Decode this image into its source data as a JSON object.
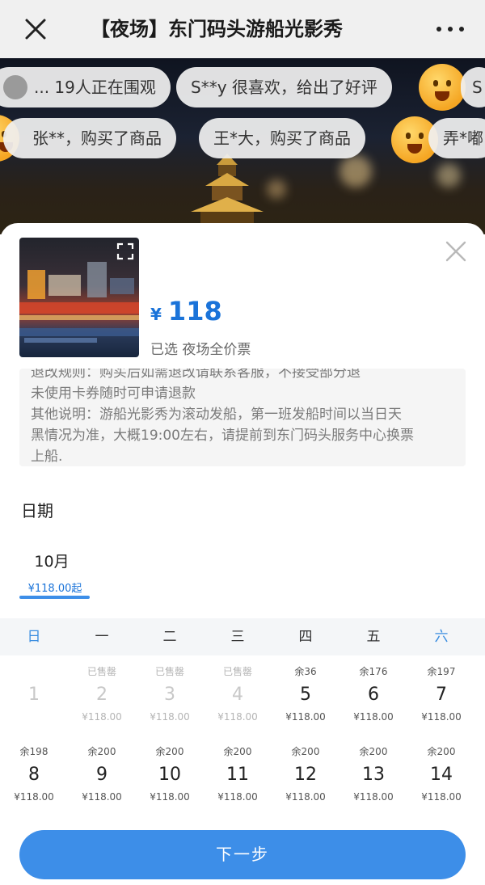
{
  "nav": {
    "title": "【夜场】东门码头游船光影秀"
  },
  "hero": {
    "bubbles": [
      {
        "text": "... 19人正在围观"
      },
      {
        "text": "S**y 很喜欢，给出了好评"
      },
      {
        "text": "S"
      },
      {
        "text": "张**，购买了商品"
      },
      {
        "text": "王*大，购买了商品"
      },
      {
        "text": "弄*嘟"
      }
    ]
  },
  "product": {
    "currency": "¥",
    "price": "118",
    "selected_prefix": "已选",
    "selected_name": "夜场全价票"
  },
  "info": {
    "lines": [
      "退改规则：购买后如需退改请联系客服，不接受部分退",
      "未使用卡券随时可申请退款",
      "其他说明：游船光影秀为滚动发船，第一班发船时间以当日天",
      "黑情况为准，大概19:00左右，请提前到东门码头服务中心换票",
      "上船."
    ]
  },
  "date": {
    "label": "日期",
    "month": "10月",
    "month_price": "¥118.00起"
  },
  "weekdays": [
    "日",
    "一",
    "二",
    "三",
    "四",
    "五",
    "六"
  ],
  "calendar": {
    "rows": [
      [
        {
          "avail": "",
          "day": "1",
          "price": "",
          "disabled": true
        },
        {
          "avail": "已售罄",
          "day": "2",
          "price": "¥118.00",
          "disabled": true
        },
        {
          "avail": "已售罄",
          "day": "3",
          "price": "¥118.00",
          "disabled": true
        },
        {
          "avail": "已售罄",
          "day": "4",
          "price": "¥118.00",
          "disabled": true
        },
        {
          "avail": "余36",
          "day": "5",
          "price": "¥118.00",
          "disabled": false
        },
        {
          "avail": "余176",
          "day": "6",
          "price": "¥118.00",
          "disabled": false
        },
        {
          "avail": "余197",
          "day": "7",
          "price": "¥118.00",
          "disabled": false
        }
      ],
      [
        {
          "avail": "余198",
          "day": "8",
          "price": "¥118.00",
          "disabled": false
        },
        {
          "avail": "余200",
          "day": "9",
          "price": "¥118.00",
          "disabled": false
        },
        {
          "avail": "余200",
          "day": "10",
          "price": "¥118.00",
          "disabled": false
        },
        {
          "avail": "余200",
          "day": "11",
          "price": "¥118.00",
          "disabled": false
        },
        {
          "avail": "余200",
          "day": "12",
          "price": "¥118.00",
          "disabled": false
        },
        {
          "avail": "余200",
          "day": "13",
          "price": "¥118.00",
          "disabled": false
        },
        {
          "avail": "余200",
          "day": "14",
          "price": "¥118.00",
          "disabled": false
        }
      ]
    ]
  },
  "footer": {
    "next_label": "下一步"
  },
  "colors": {
    "accent": "#3d8ee8",
    "price_blue": "#1a73d9",
    "weekend": "#3a8de0"
  },
  "icons": {
    "close": "close-icon",
    "more": "more-icon",
    "expand": "expand-icon",
    "sheet_close": "close-icon"
  }
}
